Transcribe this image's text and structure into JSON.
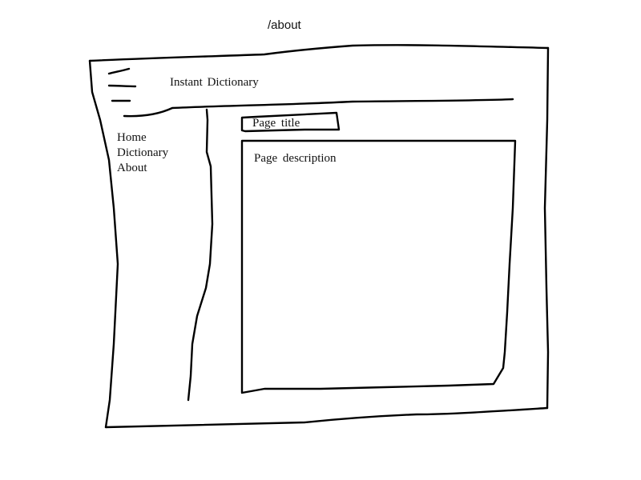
{
  "route": "/about",
  "header": {
    "menu_icon": "hamburger-menu-icon",
    "app_title": "Instant Dictionary"
  },
  "sidebar": {
    "items": [
      {
        "label": "Home"
      },
      {
        "label": "Dictionary"
      },
      {
        "label": "About"
      }
    ]
  },
  "main": {
    "page_title": "Page title",
    "page_description": "Page description"
  }
}
